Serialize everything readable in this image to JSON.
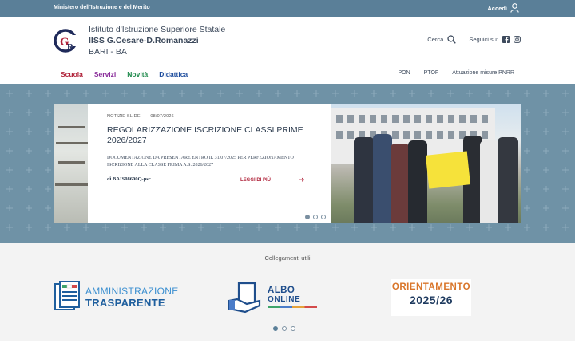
{
  "topbar": {
    "ministry": "Ministero dell'Istruzione e del Merito",
    "login": "Accedi"
  },
  "header": {
    "line1": "Istituto d'Istruzione Superiore Statale",
    "line2": "IISS G.Cesare-D.Romanazzi",
    "line3": "BARI - BA",
    "search_label": "Cerca",
    "follow_label": "Seguici su:"
  },
  "mainnav": [
    {
      "label": "Scuola",
      "color": "#b0233a"
    },
    {
      "label": "Servizi",
      "color": "#8a2d9a"
    },
    {
      "label": "Novità",
      "color": "#1f8a4c"
    },
    {
      "label": "Didattica",
      "color": "#1f4e9e"
    }
  ],
  "subnav": [
    "PON",
    "PTOF",
    "Attuazione misure PNRR"
  ],
  "slide": {
    "category": "NOTIZIE SLIDE",
    "date": "08/07/2026",
    "title": "REGOLARIZZAZIONE ISCRIZIONE CLASSI PRIME 2026/2027",
    "description": "DOCUMENTAZIONE DA PRESENTARE ENTRO IL 31/07/2025 PER PERFEZIONAMENTO ISCRIZIONE ALLA CLASSE PRIMA A.S. 2026/2027",
    "author": "di BAIS08600Q-psc",
    "read_more": "LEGGI DI PIÙ"
  },
  "links": {
    "title": "Collegamenti utili",
    "amm_line1": "AMMINISTRAZIONE",
    "amm_line2": "TRASPARENTE",
    "albo_line1": "ALBO",
    "albo_line2": "ONLINE",
    "orient_line1": "ORIENTAMENTO",
    "orient_line2": "2025/26"
  },
  "colors": {
    "topbar": "#5a7f98",
    "hero": "#6f92a6",
    "accent": "#b0233a"
  }
}
